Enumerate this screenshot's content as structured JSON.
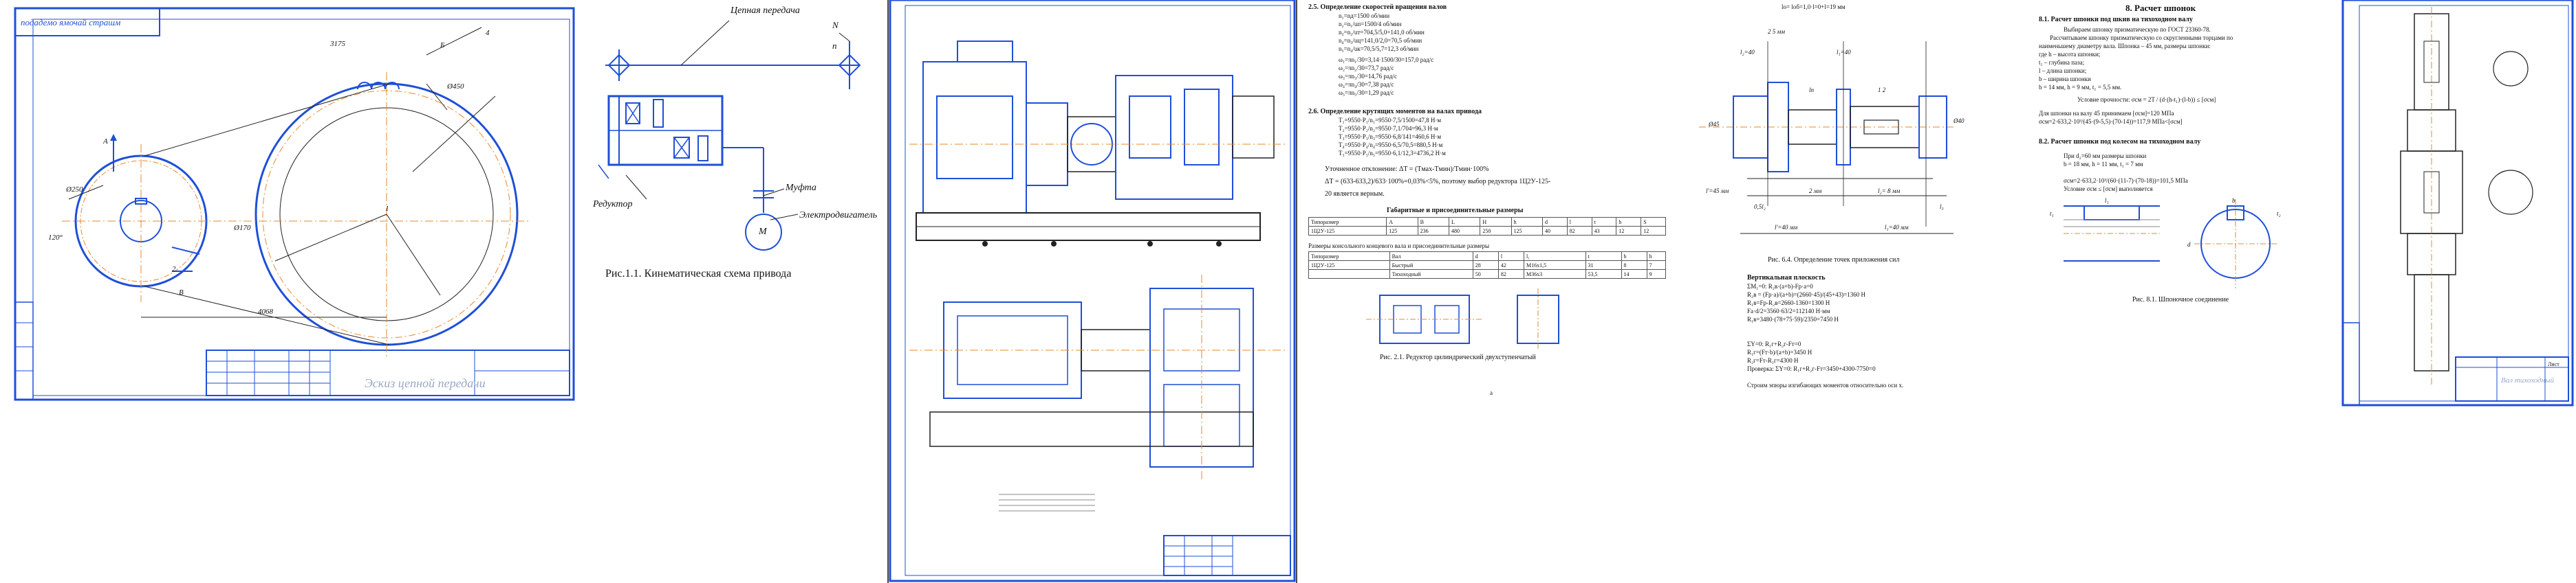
{
  "sheet1": {
    "stamp_top": "подадемо ямочай страшм",
    "title": "Эскиз цепной передачи",
    "dims": [
      "Ø250",
      "120°",
      "Ø170",
      "4068",
      "2",
      "3175",
      "4",
      "Ø450",
      "1"
    ],
    "letters": [
      "A",
      "Б",
      "B"
    ]
  },
  "kinematic": {
    "label_chain": "Цепная передача",
    "label_reducer": "Редуктор",
    "label_coupling": "Муфта",
    "label_motor": "Электродвигатель",
    "label_motor_symbol": "M",
    "label_n_vyh": "N",
    "label_p_vyh": "n",
    "caption": "Рис.1.1. Кинематическая схема привода"
  },
  "doc2": {
    "section_25": "2.5.  Определение скоростей вращения валов",
    "lines_25": [
      "n₁=nд=1500 об/мин",
      "n₂=n₁/uп=1500/4 об/мин",
      "n₃=n₂/uт=704,5/5,0=141,0 об/мин",
      "n₄=n₃/uц=141,0/2,0=70,5 об/мин",
      "n₅=n₄/uк=70,5/5,7=12,3 об/мин",
      "ω₁=πn₁/30=3,14·1500/30=157,0 рад/с",
      "ω₂=πn₂/30=73,7 рад/с",
      "ω₃=πn₃/30=14,76 рад/с",
      "ω₄=πn₄/30=7,38 рад/с",
      "ω₅=πn₅/30=1,29 рад/с"
    ],
    "section_26": "2.6.  Определение крутящих моментов на валах привода",
    "lines_26": [
      "T₁=9550·P₁/n₁=9550·7,5/1500=47,8 Н·м",
      "T₂=9550·P₂/n₂=9550·7,1/704=96,3 Н·м",
      "T₃=9550·P₃/n₃=9550·6,8/141=460,6 Н·м",
      "T₄=9550·P₄/n₄=9550·6,5/70,5=880,5 Н·м",
      "T₅=9550·P₅/n₅=9550·6,1/12,3=4736,2 Н·м"
    ],
    "check_line": "Уточненное отклонение: ΔT = (Tмах-Tмин)/Tмин·100%",
    "check_line2": "ΔT = (633-633,2)/633·100%=0,03%<5%, поэтому выбор редуктора 1Ц2У-125-",
    "check_line3": "20 является верным.",
    "table_title": "Габаритные и присоединительные размеры",
    "table2_title": "Размеры консольного концевого вала и присоединительные размеры",
    "table_head": [
      "Типоразмер",
      "A",
      "B",
      "L",
      "H",
      "h",
      "d",
      "l",
      "t",
      "b",
      "S"
    ],
    "table_row": [
      "1Ц2У-125",
      "125",
      "236",
      "480",
      "250",
      "125",
      "40",
      "82",
      "43",
      "12",
      "12"
    ],
    "table2_head": [
      "Типоразмер",
      "Вал",
      "d",
      "l",
      "l₁",
      "t",
      "b",
      "h"
    ],
    "table2_rows": [
      [
        "1Ц2У-125",
        "Быстрый",
        "28",
        "42",
        "M16x1,5",
        "31",
        "8",
        "7"
      ],
      [
        "",
        "Тихоходный",
        "50",
        "82",
        "M36x3",
        "53,5",
        "14",
        "9"
      ]
    ],
    "caption": "Рис. 2.1. Редуктор цилиндрический двухступенчатый",
    "page_mark": "a"
  },
  "shaft": {
    "top_formula": "lо= lоб=1,0·l=0+l=19 мм",
    "dims": [
      "2 5 мм",
      "l₂=40",
      "l₁=40",
      "Ø45",
      "Ø40",
      "lп",
      "1 2",
      "l'=45 мм",
      "2 мм",
      "l₂= 8 мм",
      "0,5l₂",
      "l₃",
      "l'=40 мм",
      "l₁=40 мм"
    ],
    "caption": "Рис. 6.4. Определение точек приложения сил",
    "section_title": "Вертикальная плоскость",
    "lines": [
      "ΣM₁=0: R₂в·(a+b)-Fр·a=0",
      "R₂в = (Fр·a)/(a+b)=(2660·45)/(45+43)=1360 Н",
      "R₁в=Fр-R₂в=2660-1360=1300 Н",
      "Fа·d/2=3560·63/2=112140 Н·мм",
      "R₁в=3480·(78+75·59)/2350=7450 Н"
    ],
    "section_title2": "",
    "lines2": [
      "ΣY=0: R₁г+R₂г-Fт=0",
      "R₁г=(Fт·b)/(a+b)=3450 Н",
      "R₂г=Fт-R₁г=4300 Н",
      "Проверка: ΣY=0: R₁г+R₂г-Fт=3450+4300-7750=0"
    ],
    "footer": "Строим эпюры изгибающих моментов относительно оси x."
  },
  "keys": {
    "title": "8. Расчет шпонок",
    "s81": "8.1. Расчет шпонки под шкив на тихоходном валу",
    "s81_lines": [
      "Выбираем шпонку призматическую по ГОСТ 23360-78.",
      "Рассчитываем шпонку призматическую со скругленными торцами по",
      "наименьшему диаметру вала. Шпонка – 45 мм, размеры шпонки:",
      "где h – высота шпонки;",
      "t₁ – глубина паза;",
      "l – длина шпонки;",
      "b – ширина шпонки",
      "b = 14 мм, h = 9 мм, t₁ = 5,5 мм."
    ],
    "s81_formula": "Условие прочности: σсм = 2T / (d·(h-t₁)·(l-b)) ≤ [σсм]",
    "s81_calc1": "Для шпонки на валу 45 принимаем [σсм]=120 МПа",
    "s81_calc2": "σсм=2·633,2·10³/(45·(9-5,5)·(70-14))=117,9 МПа<[σсм]",
    "s82": "8.2. Расчет шпонки под колесом на тихоходном валу",
    "s82_lines": [
      "При d₂=60 мм размеры шпонки",
      "b = 18 мм, h = 11 мм, t₁ = 7 мм",
      "",
      "σсм=2·633,2·10³/(60·(11-7)·(70-18))=101,5 МПа",
      "Условие σсм ≤ [σсм] выполняется"
    ],
    "caption": "Рис. 8.1. Шпоночное соединение",
    "marks": [
      "l₁",
      "t₁",
      "b",
      "t₂",
      "d"
    ]
  },
  "sheet_last": {
    "title": "Вал тихоходный",
    "stamp": "Лист"
  },
  "colors": {
    "blue": "#1e4fd8",
    "orange": "#e8882a",
    "dark": "#222222"
  }
}
